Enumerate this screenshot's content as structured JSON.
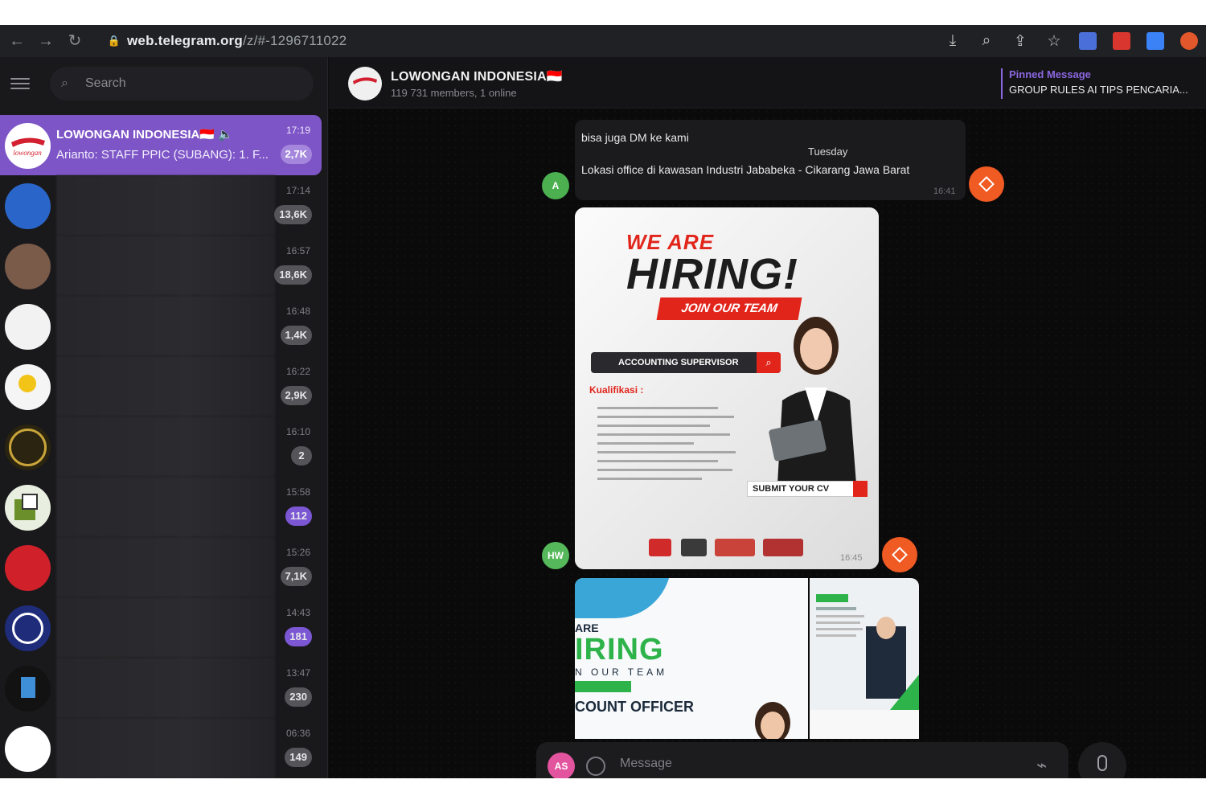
{
  "browser": {
    "url_host": "web.telegram.org",
    "url_path": "/z/#-1296711022"
  },
  "sidebar": {
    "search_placeholder": "Search",
    "chats": [
      {
        "title": "LOWONGAN INDONESIA🇮🇩 🔈",
        "preview": "Arianto: STAFF PPIC (SUBANG): 1. F...",
        "time": "17:19",
        "badge": "2,7K",
        "active": true
      },
      {
        "time": "17:14",
        "badge": "13,6K"
      },
      {
        "time": "16:57",
        "badge": "18,6K"
      },
      {
        "time": "16:48",
        "badge": "1,4K"
      },
      {
        "time": "16:22",
        "badge": "2,9K"
      },
      {
        "time": "16:10",
        "badge": "2"
      },
      {
        "time": "15:58",
        "badge": "112"
      },
      {
        "time": "15:26",
        "badge": "7,1K"
      },
      {
        "time": "14:43",
        "badge": "181"
      },
      {
        "time": "13:47",
        "badge": "230"
      },
      {
        "time": "06:36",
        "badge": "149"
      }
    ]
  },
  "header": {
    "title": "LOWONGAN INDONESIA🇮🇩",
    "subtitle": "119 731 members, 1 online",
    "pinned_label": "Pinned Message",
    "pinned_text": "GROUP RULES AI TIPS PENCARIA..."
  },
  "messages": {
    "line1": "bisa juga DM ke kami",
    "date": "Tuesday",
    "line2": "Lokasi office di kawasan Industri Jababeka - Cikarang Jawa Barat",
    "time1": "16:41",
    "sender1": "A",
    "sender2": "HW",
    "time2": "16:45"
  },
  "poster": {
    "we_are": "WE ARE",
    "hiring": "HIRING!",
    "join": "JOIN OUR TEAM",
    "position": "ACCOUNTING SUPERVISOR",
    "kualifikasi": "Kualifikasi :",
    "submit": "SUBMIT YOUR CV"
  },
  "poster2": {
    "are": "ARE",
    "iring": "IRING",
    "team": "N OUR TEAM",
    "officer": "COUNT OFFICER"
  },
  "composer": {
    "avatar": "AS",
    "placeholder": "Message"
  }
}
